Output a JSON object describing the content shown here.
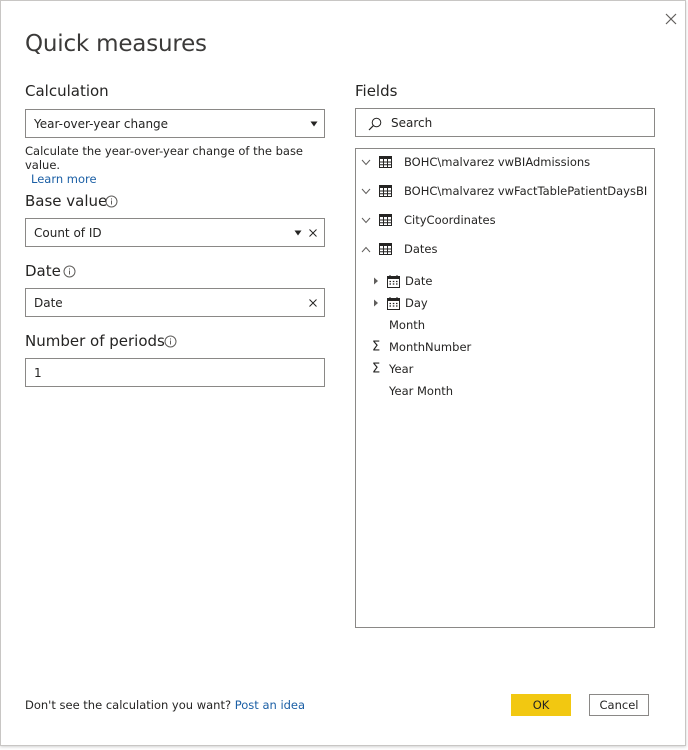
{
  "dialog": {
    "title": "Quick measures"
  },
  "calculation": {
    "label": "Calculation",
    "selected": "Year-over-year change",
    "description": "Calculate the year-over-year change of the base value.",
    "learn_more": "Learn more"
  },
  "base_value": {
    "label": "Base value",
    "value": "Count of ID"
  },
  "date": {
    "label": "Date",
    "value": "Date"
  },
  "periods": {
    "label": "Number of periods",
    "value": "1"
  },
  "fields": {
    "label": "Fields",
    "search_placeholder": "Search",
    "tables": [
      {
        "name": "BOHC\\malvarez vwBIAdmissions",
        "expanded": false
      },
      {
        "name": "BOHC\\malvarez vwFactTablePatientDaysBI",
        "expanded": false
      },
      {
        "name": "CityCoordinates",
        "expanded": false
      },
      {
        "name": "Dates",
        "expanded": true
      }
    ],
    "dates_children": [
      {
        "name": "Date",
        "kind": "hierarchy"
      },
      {
        "name": "Day",
        "kind": "hierarchy"
      },
      {
        "name": "Month",
        "kind": "text"
      },
      {
        "name": "MonthNumber",
        "kind": "sum"
      },
      {
        "name": "Year",
        "kind": "sum"
      },
      {
        "name": "Year Month",
        "kind": "text"
      }
    ]
  },
  "footer": {
    "prompt": "Don't see the calculation you want?",
    "post_idea": "Post an idea",
    "ok": "OK",
    "cancel": "Cancel"
  },
  "icons": {
    "close": "close-icon",
    "dropdown": "caret-down-icon",
    "clear": "clear-icon",
    "info": "info-icon",
    "search": "search-icon",
    "table": "table-icon",
    "chevron": "chevron-icon",
    "calendar": "calendar-icon",
    "sigma": "sigma-icon"
  },
  "colors": {
    "accent": "#f2c811",
    "link": "#1b5fa5",
    "border": "#8a8886"
  }
}
